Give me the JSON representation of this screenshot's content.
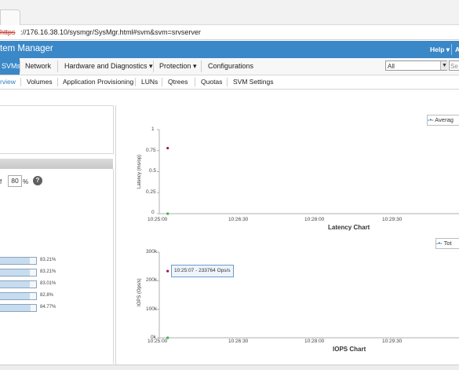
{
  "browser": {
    "url_scheme": "https",
    "url_rest": "://176.16.38.10/sysmgr/SysMgr.html#svm&svm=srvserver"
  },
  "header": {
    "title": "tem Manager",
    "help": "Help ▾",
    "other": "A"
  },
  "nav": {
    "items": [
      "SVMs",
      "Network",
      "Hardware and Diagnostics ▾",
      "Protection ▾",
      "Configurations"
    ],
    "filter_value": "All",
    "search_placeholder": "Se"
  },
  "subnav": {
    "items": [
      "rview",
      "Volumes",
      "Application Provisioning",
      "LUNs",
      "Qtrees",
      "Quotas",
      "SVM Settings"
    ]
  },
  "threshold": {
    "label": "f",
    "value": "80",
    "unit": "%",
    "help": "?"
  },
  "volume_bars": [
    {
      "label": "83.21%",
      "fraction": 0.83
    },
    {
      "label": "83.21%",
      "fraction": 0.83
    },
    {
      "label": "83.01%",
      "fraction": 0.83
    },
    {
      "label": "82.8%",
      "fraction": 0.83
    },
    {
      "label": "84.77%",
      "fraction": 0.85
    }
  ],
  "colors": {
    "header_blue": "#3a88c8",
    "bar_fill": "#c7dcef",
    "point_red": "#a0143c",
    "point_green": "#3cb043",
    "legend_blue": "#3a6ea5"
  },
  "chart_data": [
    {
      "type": "scatter",
      "title": "Latency Chart",
      "ylabel": "Latency (ms/op)",
      "xlabel": "",
      "y_ticks": [
        "1",
        "0.75",
        "0.5",
        "0.25",
        "0"
      ],
      "x_ticks": [
        "10:25:00",
        "10:26:30",
        "10:28:00",
        "10:29:30"
      ],
      "ylim": [
        0,
        1
      ],
      "legend": "Averag",
      "legend_symbol": "-•-",
      "points": [
        {
          "time": "10:25:07",
          "y": 0.78,
          "color": "#a0143c"
        },
        {
          "time": "10:25:07",
          "y": 0,
          "color": "#3cb043"
        }
      ]
    },
    {
      "type": "scatter",
      "title": "IOPS Chart",
      "ylabel": "IOPS (Ops/s)",
      "xlabel": "",
      "y_ticks": [
        "300k",
        "200k",
        "100k",
        "0k"
      ],
      "x_ticks": [
        "10:25:00",
        "10:26:30",
        "10:28:00",
        "10:29:30"
      ],
      "ylim": [
        0,
        300000
      ],
      "legend": "Tot",
      "legend_symbol": "-•-",
      "tooltip": "10:25:07 - 233764 Ops/s",
      "points": [
        {
          "time": "10:25:07",
          "y": 233764,
          "color": "#a0143c"
        },
        {
          "time": "10:25:07",
          "y": 0,
          "color": "#3cb043"
        }
      ]
    }
  ]
}
